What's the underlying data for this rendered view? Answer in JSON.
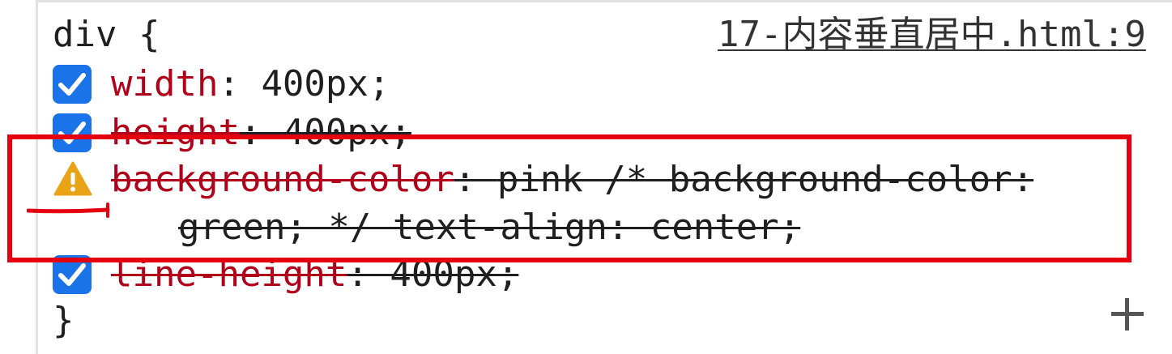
{
  "rule": {
    "selector": "div {",
    "source": "17-内容垂直居中.html:9",
    "closing": "}"
  },
  "declarations": [
    {
      "property": "width",
      "separator": ": ",
      "value": "400px;",
      "enabled": true,
      "overridden": false
    },
    {
      "property": "height",
      "separator": ": ",
      "value": "400px;",
      "enabled": true,
      "overridden": true
    },
    {
      "property": "background-color",
      "separator": ": ",
      "value": "pink /* background-color:",
      "continuation": "green; */ text-align: center;",
      "enabled": true,
      "warning": true,
      "overridden": true
    },
    {
      "property": "line-height",
      "separator": ": ",
      "value": "400px;",
      "enabled": true,
      "overridden": true
    }
  ],
  "colors": {
    "property": "#b0001a",
    "checkbox": "#1a73e8",
    "warning": "#e8a317",
    "annotation": "#e4000f"
  },
  "icons": {
    "checkbox": "checkbox-checked-icon",
    "warning": "warning-triangle-icon",
    "add": "plus-icon"
  }
}
